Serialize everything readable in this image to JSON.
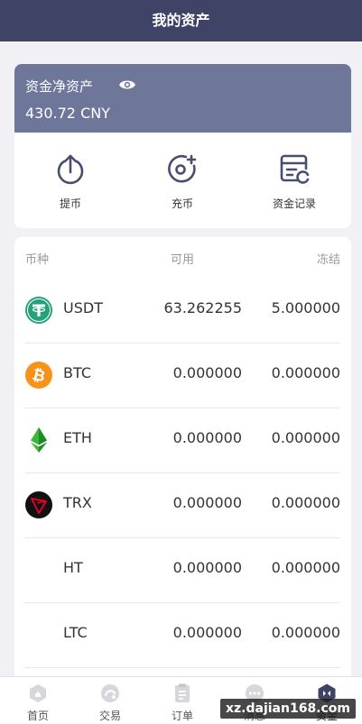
{
  "header": {
    "title": "我的资产"
  },
  "balance": {
    "label": "资金净资产",
    "value": "430.72 CNY"
  },
  "actions": [
    {
      "label": "提币",
      "icon": "withdraw-icon"
    },
    {
      "label": "充币",
      "icon": "deposit-icon"
    },
    {
      "label": "资金记录",
      "icon": "fund-record-icon"
    }
  ],
  "table": {
    "headers": {
      "coin": "币种",
      "available": "可用",
      "frozen": "冻结"
    },
    "rows": [
      {
        "symbol": "USDT",
        "available": "63.262255",
        "frozen": "5.000000",
        "icon": "usdt-icon",
        "color": "#26a17b"
      },
      {
        "symbol": "BTC",
        "available": "0.000000",
        "frozen": "0.000000",
        "icon": "btc-icon",
        "color": "#f7931a"
      },
      {
        "symbol": "ETH",
        "available": "0.000000",
        "frozen": "0.000000",
        "icon": "eth-icon",
        "color": "#3ab83a"
      },
      {
        "symbol": "TRX",
        "available": "0.000000",
        "frozen": "0.000000",
        "icon": "trx-icon",
        "color": "#ef0027"
      },
      {
        "symbol": "HT",
        "available": "0.000000",
        "frozen": "0.000000",
        "icon": "",
        "color": ""
      },
      {
        "symbol": "LTC",
        "available": "0.000000",
        "frozen": "0.000000",
        "icon": "",
        "color": ""
      }
    ]
  },
  "tabs": [
    {
      "label": "首页",
      "icon": "home-icon"
    },
    {
      "label": "交易",
      "icon": "trade-icon"
    },
    {
      "label": "订单",
      "icon": "order-icon"
    },
    {
      "label": "消息",
      "icon": "message-icon"
    },
    {
      "label": "资金",
      "icon": "funds-icon",
      "active": true
    }
  ],
  "watermark": "xz.dajian168.com",
  "colors": {
    "header": "#3f4366",
    "card": "#6e7799",
    "accent": "#3f4366"
  }
}
